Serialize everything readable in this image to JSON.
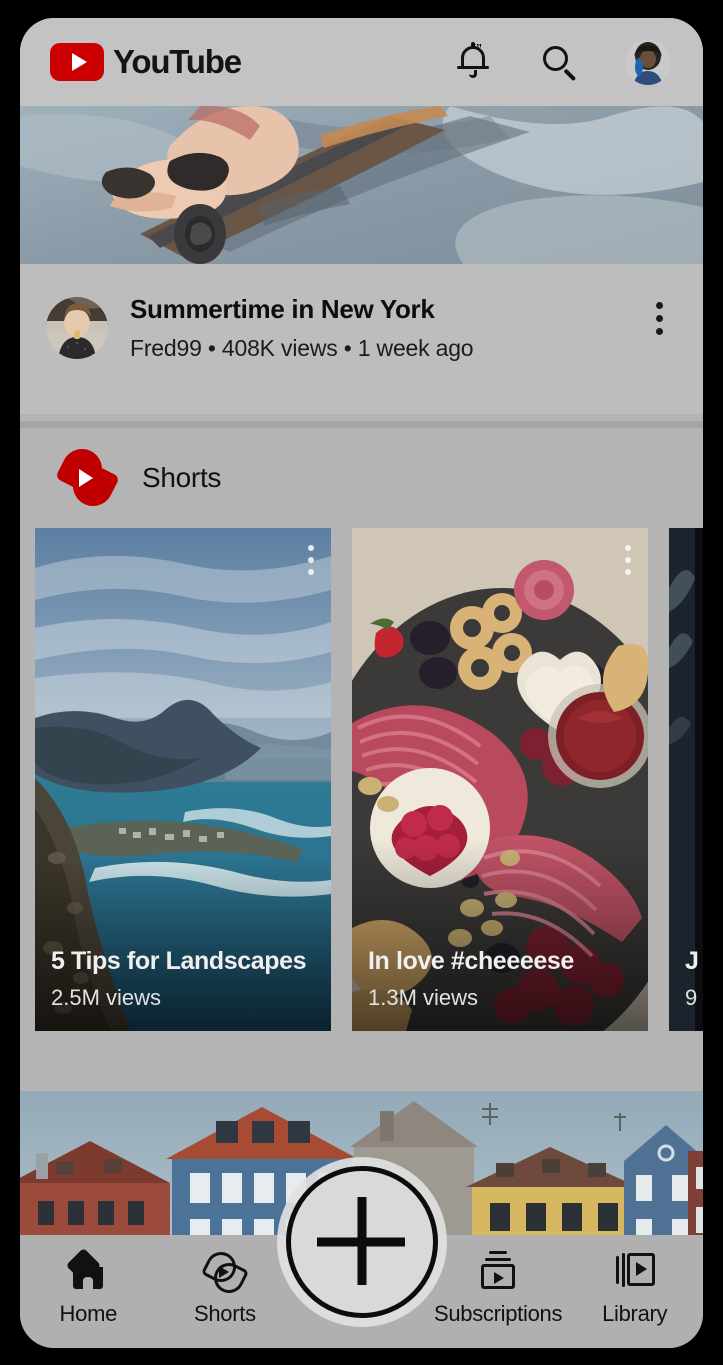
{
  "app": {
    "name": "YouTube",
    "logo_color": "#cc0000"
  },
  "header": {
    "brand": "YouTube",
    "notifications_icon": "bell-icon",
    "search_icon": "search-icon",
    "account_icon": "avatar"
  },
  "feed": {
    "video": {
      "title": "Summertime in New York",
      "channel": "Fred99",
      "views": "408K views",
      "age": "1 week ago",
      "meta_line": "Fred99 • 408K views • 1 week ago",
      "menu_icon": "kebab-menu-icon"
    }
  },
  "shorts": {
    "section_title": "Shorts",
    "logo_icon": "shorts-logo-icon",
    "cards": [
      {
        "title": "5 Tips for Landscapes",
        "views": "2.5M views"
      },
      {
        "title": "In love #cheeeese",
        "views": "1.3M views"
      },
      {
        "title": "J",
        "views": "9"
      }
    ]
  },
  "bottom_nav": {
    "items": [
      {
        "label": "Home",
        "icon": "home-icon",
        "active": true
      },
      {
        "label": "Shorts",
        "icon": "shorts-icon",
        "active": false
      },
      {
        "label": "Subscriptions",
        "icon": "subscriptions-icon",
        "active": false
      },
      {
        "label": "Library",
        "icon": "library-icon",
        "active": false
      }
    ],
    "create_button": {
      "label": "+",
      "icon": "plus-icon"
    }
  }
}
